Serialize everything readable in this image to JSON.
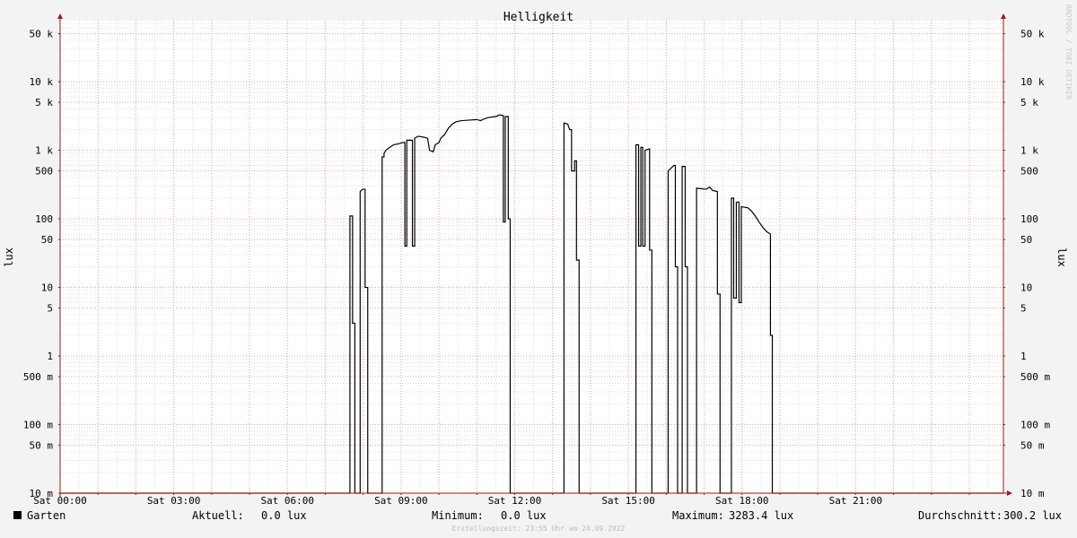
{
  "colors": {
    "background": "#f3f3f3",
    "plot_background": "#ffffff",
    "minor_grid": "#dddddd",
    "major_grid": "#e8a3a8",
    "axis": "#a01818",
    "line": "#000000",
    "text": "#000000",
    "watermark": "#cccccc"
  },
  "watermark": "RRDTOOL / TOBI OETIKER",
  "footer": "Erstellungszeit: 23:55 Uhr am 24.09.2022",
  "legend": {
    "swatch_color": "#000000",
    "series_label": "Garten",
    "current_label": "Aktuell:",
    "current_value": "0.0 lux",
    "min_label": "Minimum:",
    "min_value": "0.0 lux",
    "max_label": "Maximum:",
    "max_value": "3283.4 lux",
    "avg_label": "Durchschnitt:",
    "avg_value": "300.2 lux"
  },
  "chart_data": {
    "type": "line",
    "title": "Helligkeit",
    "ylabel": "lux",
    "y_scale": "log",
    "ylim": [
      0.01,
      80000
    ],
    "xlim": [
      0,
      24.9
    ],
    "x_unit": "hours since 00:00",
    "grid": true,
    "legend_position": "bottom",
    "x_ticks": [
      {
        "value": 0,
        "label": "Sat 00:00"
      },
      {
        "value": 3,
        "label": "Sat 03:00"
      },
      {
        "value": 6,
        "label": "Sat 06:00"
      },
      {
        "value": 9,
        "label": "Sat 09:00"
      },
      {
        "value": 12,
        "label": "Sat 12:00"
      },
      {
        "value": 15,
        "label": "Sat 15:00"
      },
      {
        "value": 18,
        "label": "Sat 18:00"
      },
      {
        "value": 21,
        "label": "Sat 21:00"
      }
    ],
    "y_ticks": [
      {
        "value": 0.01,
        "label": "10 m"
      },
      {
        "value": 0.05,
        "label": "50 m"
      },
      {
        "value": 0.1,
        "label": "100 m"
      },
      {
        "value": 0.5,
        "label": "500 m"
      },
      {
        "value": 1,
        "label": "1"
      },
      {
        "value": 5,
        "label": "5"
      },
      {
        "value": 10,
        "label": "10"
      },
      {
        "value": 50,
        "label": "50"
      },
      {
        "value": 100,
        "label": "100"
      },
      {
        "value": 500,
        "label": "500"
      },
      {
        "value": 1000,
        "label": "1 k"
      },
      {
        "value": 5000,
        "label": "5 k"
      },
      {
        "value": 10000,
        "label": "10 k"
      },
      {
        "value": 50000,
        "label": "50 k"
      }
    ],
    "series": [
      {
        "name": "Garten",
        "color": "#000000",
        "points": [
          [
            0,
            0.01
          ],
          [
            7.65,
            0.01
          ],
          [
            7.65,
            110
          ],
          [
            7.72,
            110
          ],
          [
            7.72,
            3
          ],
          [
            7.78,
            3
          ],
          [
            7.78,
            0.01
          ],
          [
            7.92,
            0.01
          ],
          [
            7.92,
            250
          ],
          [
            7.98,
            270
          ],
          [
            8.05,
            270
          ],
          [
            8.05,
            10
          ],
          [
            8.12,
            10
          ],
          [
            8.12,
            0.01
          ],
          [
            8.5,
            0.01
          ],
          [
            8.5,
            800
          ],
          [
            8.55,
            800
          ],
          [
            8.55,
            900
          ],
          [
            8.6,
            1000
          ],
          [
            8.7,
            1100
          ],
          [
            8.8,
            1200
          ],
          [
            8.95,
            1250
          ],
          [
            9.05,
            1300
          ],
          [
            9.1,
            1300
          ],
          [
            9.1,
            40
          ],
          [
            9.15,
            40
          ],
          [
            9.15,
            1400
          ],
          [
            9.3,
            1400
          ],
          [
            9.3,
            40
          ],
          [
            9.36,
            40
          ],
          [
            9.36,
            1500
          ],
          [
            9.45,
            1600
          ],
          [
            9.6,
            1550
          ],
          [
            9.7,
            1500
          ],
          [
            9.75,
            1000
          ],
          [
            9.85,
            950
          ],
          [
            9.9,
            1200
          ],
          [
            10.0,
            1300
          ],
          [
            10.05,
            1500
          ],
          [
            10.15,
            1700
          ],
          [
            10.25,
            2100
          ],
          [
            10.35,
            2400
          ],
          [
            10.45,
            2600
          ],
          [
            10.6,
            2700
          ],
          [
            10.8,
            2750
          ],
          [
            11.0,
            2800
          ],
          [
            11.1,
            2700
          ],
          [
            11.15,
            2800
          ],
          [
            11.3,
            3000
          ],
          [
            11.5,
            3100
          ],
          [
            11.6,
            3280
          ],
          [
            11.7,
            3200
          ],
          [
            11.7,
            90
          ],
          [
            11.75,
            90
          ],
          [
            11.75,
            3100
          ],
          [
            11.83,
            3100
          ],
          [
            11.83,
            100
          ],
          [
            11.88,
            100
          ],
          [
            11.88,
            0.01
          ],
          [
            13.3,
            0.01
          ],
          [
            13.3,
            2500
          ],
          [
            13.4,
            2400
          ],
          [
            13.45,
            2000
          ],
          [
            13.5,
            2000
          ],
          [
            13.5,
            500
          ],
          [
            13.58,
            500
          ],
          [
            13.58,
            700
          ],
          [
            13.63,
            700
          ],
          [
            13.63,
            25
          ],
          [
            13.7,
            25
          ],
          [
            13.7,
            0.01
          ],
          [
            15.2,
            0.01
          ],
          [
            15.2,
            1200
          ],
          [
            15.27,
            1200
          ],
          [
            15.27,
            40
          ],
          [
            15.33,
            40
          ],
          [
            15.33,
            1100
          ],
          [
            15.38,
            1100
          ],
          [
            15.38,
            40
          ],
          [
            15.44,
            40
          ],
          [
            15.44,
            1000
          ],
          [
            15.56,
            1050
          ],
          [
            15.56,
            35
          ],
          [
            15.62,
            35
          ],
          [
            15.62,
            0.01
          ],
          [
            16.05,
            0.01
          ],
          [
            16.05,
            500
          ],
          [
            16.13,
            550
          ],
          [
            16.2,
            600
          ],
          [
            16.24,
            600
          ],
          [
            16.24,
            20
          ],
          [
            16.3,
            20
          ],
          [
            16.3,
            0.01
          ],
          [
            16.42,
            0.01
          ],
          [
            16.42,
            580
          ],
          [
            16.5,
            580
          ],
          [
            16.5,
            20
          ],
          [
            16.56,
            20
          ],
          [
            16.56,
            0.01
          ],
          [
            16.8,
            0.01
          ],
          [
            16.8,
            280
          ],
          [
            17.05,
            270
          ],
          [
            17.15,
            290
          ],
          [
            17.22,
            260
          ],
          [
            17.35,
            250
          ],
          [
            17.35,
            8
          ],
          [
            17.42,
            8
          ],
          [
            17.42,
            0.01
          ],
          [
            17.72,
            0.01
          ],
          [
            17.72,
            200
          ],
          [
            17.78,
            200
          ],
          [
            17.78,
            7
          ],
          [
            17.85,
            7
          ],
          [
            17.85,
            175
          ],
          [
            17.92,
            175
          ],
          [
            17.92,
            6
          ],
          [
            17.98,
            6
          ],
          [
            17.98,
            150
          ],
          [
            18.15,
            145
          ],
          [
            18.25,
            130
          ],
          [
            18.35,
            110
          ],
          [
            18.45,
            90
          ],
          [
            18.55,
            75
          ],
          [
            18.65,
            65
          ],
          [
            18.75,
            60
          ],
          [
            18.75,
            2
          ],
          [
            18.8,
            2
          ],
          [
            18.8,
            0.01
          ],
          [
            24.9,
            0.01
          ]
        ]
      }
    ]
  }
}
